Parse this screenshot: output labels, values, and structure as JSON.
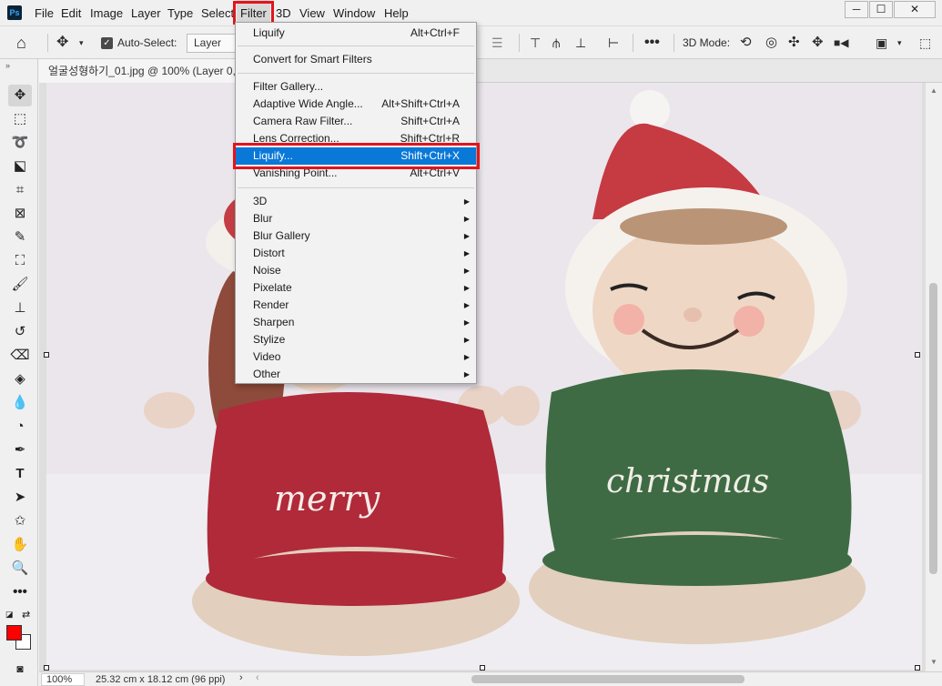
{
  "app": {
    "logo_text": "Ps",
    "document_tab": "얼굴성형하기_01.jpg @ 100% (Layer 0, RGB/8)",
    "accent_color": "#0a78d7",
    "highlight_color": "#e3141c"
  },
  "menubar": {
    "items": [
      "File",
      "Edit",
      "Image",
      "Layer",
      "Type",
      "Select",
      "Filter",
      "3D",
      "View",
      "Window",
      "Help"
    ],
    "active": "Filter"
  },
  "window_controls": {
    "minimize": "─",
    "maximize": "☐",
    "close": "✕"
  },
  "options_bar": {
    "auto_select_label": "Auto-Select:",
    "auto_select_checked": true,
    "layer_select_value": "Layer",
    "three_d_mode_label": "3D Mode:"
  },
  "filter_menu": {
    "sections": [
      [
        {
          "label": "Liquify",
          "shortcut": "Alt+Ctrl+F"
        }
      ],
      [
        {
          "label": "Convert for Smart Filters",
          "shortcut": ""
        }
      ],
      [
        {
          "label": "Filter Gallery...",
          "shortcut": ""
        },
        {
          "label": "Adaptive Wide Angle...",
          "shortcut": "Alt+Shift+Ctrl+A"
        },
        {
          "label": "Camera Raw Filter...",
          "shortcut": "Shift+Ctrl+A"
        },
        {
          "label": "Lens Correction...",
          "shortcut": "Shift+Ctrl+R"
        },
        {
          "label": "Liquify...",
          "shortcut": "Shift+Ctrl+X",
          "hovered": true
        },
        {
          "label": "Vanishing Point...",
          "shortcut": "Alt+Ctrl+V"
        }
      ],
      [
        {
          "label": "3D",
          "submenu": true
        },
        {
          "label": "Blur",
          "submenu": true
        },
        {
          "label": "Blur Gallery",
          "submenu": true
        },
        {
          "label": "Distort",
          "submenu": true
        },
        {
          "label": "Noise",
          "submenu": true
        },
        {
          "label": "Pixelate",
          "submenu": true
        },
        {
          "label": "Render",
          "submenu": true
        },
        {
          "label": "Sharpen",
          "submenu": true
        },
        {
          "label": "Stylize",
          "submenu": true
        },
        {
          "label": "Video",
          "submenu": true
        },
        {
          "label": "Other",
          "submenu": true
        }
      ]
    ]
  },
  "canvas": {
    "left_doll_text": "merry",
    "right_doll_text": "christmas",
    "colors": {
      "red": "#b02a3a",
      "green": "#3e6b44",
      "cream": "#e2cfbd",
      "skin": "#efd7c6"
    }
  },
  "statusbar": {
    "zoom": "100%",
    "doc_size": "25.32 cm x 18.12 cm (96 ppi)"
  }
}
